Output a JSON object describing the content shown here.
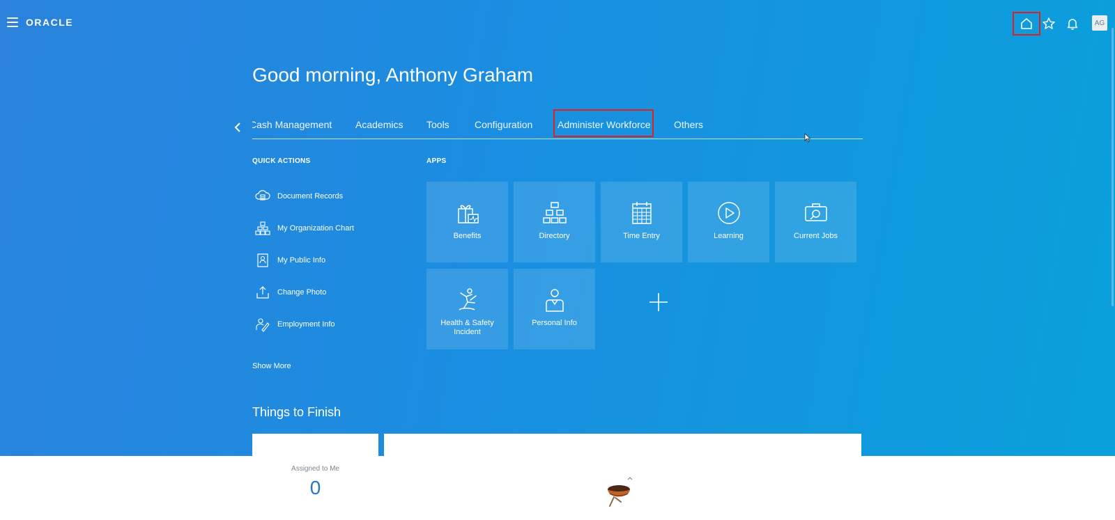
{
  "header": {
    "brand": "ORACLE",
    "avatar_initials": "AG"
  },
  "greeting": "Good morning, Anthony Graham",
  "tabs": [
    {
      "label": "Cash Management"
    },
    {
      "label": "Academics"
    },
    {
      "label": "Tools"
    },
    {
      "label": "Configuration"
    },
    {
      "label": "Administer Workforce"
    },
    {
      "label": "Others"
    }
  ],
  "quick_actions": {
    "title": "QUICK ACTIONS",
    "items": [
      {
        "label": "Document Records",
        "icon": "document-records-icon"
      },
      {
        "label": "My Organization Chart",
        "icon": "org-chart-icon"
      },
      {
        "label": "My Public Info",
        "icon": "public-info-icon"
      },
      {
        "label": "Change Photo",
        "icon": "change-photo-icon"
      },
      {
        "label": "Employment Info",
        "icon": "employment-info-icon"
      }
    ],
    "show_more": "Show More"
  },
  "apps": {
    "title": "APPS",
    "tiles": [
      {
        "label": "Benefits",
        "icon": "gift-icon"
      },
      {
        "label": "Directory",
        "icon": "hierarchy-icon"
      },
      {
        "label": "Time Entry",
        "icon": "calendar-icon"
      },
      {
        "label": "Learning",
        "icon": "play-icon"
      },
      {
        "label": "Current Jobs",
        "icon": "job-search-icon"
      },
      {
        "label": "Health & Safety Incident",
        "icon": "fall-icon"
      },
      {
        "label": "Personal Info",
        "icon": "person-badge-icon"
      }
    ]
  },
  "things_to_finish": {
    "title": "Things to Finish",
    "assigned_label": "Assigned to Me",
    "assigned_count": "0"
  },
  "colors": {
    "hero_start": "#2a82dc",
    "hero_end": "#0aa0dc",
    "highlight": "#e02020",
    "count": "#2a76c4"
  }
}
